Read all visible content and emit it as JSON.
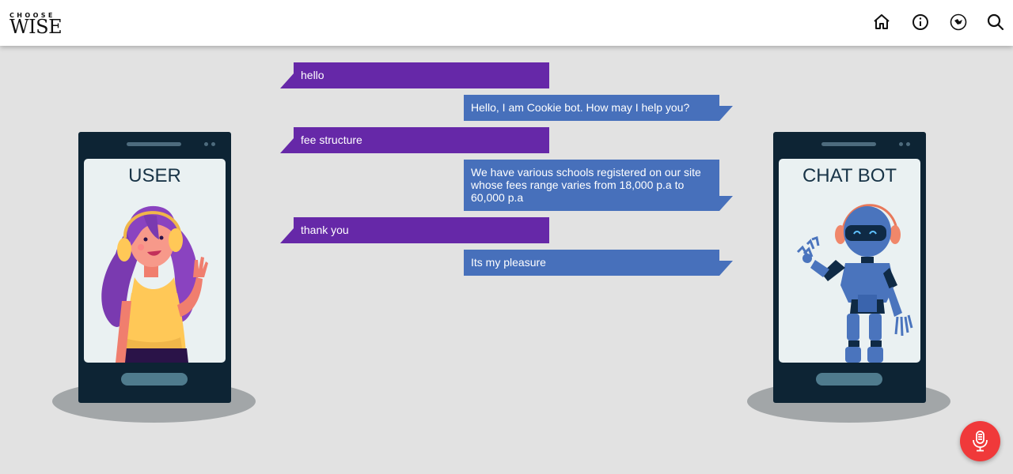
{
  "header": {
    "logo": {
      "top_text": "CHOOSE",
      "bottom_text": "WISE"
    },
    "icons": [
      "home-icon",
      "info-icon",
      "compass-icon",
      "search-icon"
    ]
  },
  "user_phone": {
    "label": "USER"
  },
  "bot_phone": {
    "label": "CHAT BOT"
  },
  "chat": {
    "messages": [
      {
        "sender": "user",
        "text": "hello"
      },
      {
        "sender": "bot",
        "text": "Hello, I am Cookie bot. How may I help you?"
      },
      {
        "sender": "user",
        "text": "fee structure"
      },
      {
        "sender": "bot",
        "text": "We have various schools registered on our site whose fees range varies from 18,000 p.a to 60,000 p.a"
      },
      {
        "sender": "user",
        "text": "thank you"
      },
      {
        "sender": "bot",
        "text": "Its my pleasure"
      }
    ]
  },
  "mic": {
    "icon": "microphone-icon"
  },
  "colors": {
    "user_bubble": "#6628a8",
    "bot_bubble": "#4770bb",
    "mic_button": "#f0393a",
    "background": "#e2e2e2",
    "phone_body": "#0d2434"
  }
}
